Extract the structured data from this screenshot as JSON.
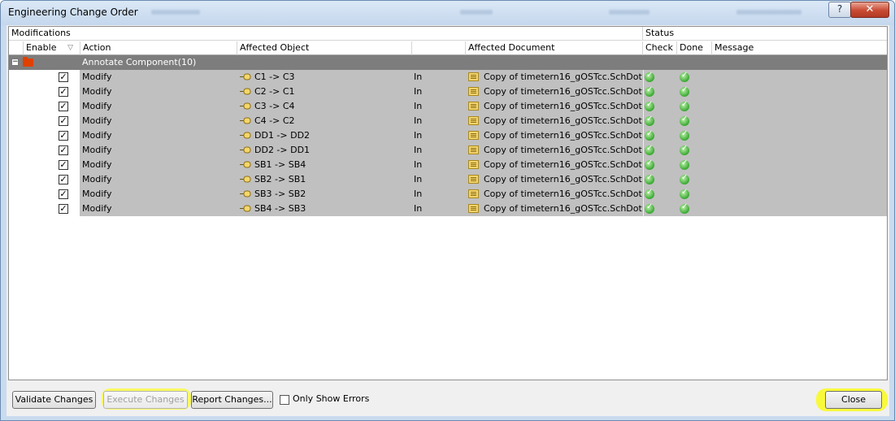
{
  "window": {
    "title": "Engineering Change Order",
    "help_button": "?",
    "close_button": "✕"
  },
  "headers": {
    "group_modifications": "Modifications",
    "group_status": "Status",
    "enable": "Enable",
    "action": "Action",
    "affected_object": "Affected Object",
    "affected_document": "Affected Document",
    "check": "Check",
    "done": "Done",
    "message": "Message"
  },
  "group": {
    "label": "Annotate Component(10)"
  },
  "rows": [
    {
      "enabled": true,
      "action": "Modify",
      "object": "C1 -> C3",
      "direction": "In",
      "document": "Copy of timetern16_gOSTcc.SchDot",
      "check": "ok",
      "done": "ok",
      "message": ""
    },
    {
      "enabled": true,
      "action": "Modify",
      "object": "C2 -> C1",
      "direction": "In",
      "document": "Copy of timetern16_gOSTcc.SchDot",
      "check": "ok",
      "done": "ok",
      "message": ""
    },
    {
      "enabled": true,
      "action": "Modify",
      "object": "C3 -> C4",
      "direction": "In",
      "document": "Copy of timetern16_gOSTcc.SchDot",
      "check": "ok",
      "done": "ok",
      "message": ""
    },
    {
      "enabled": true,
      "action": "Modify",
      "object": "C4 -> C2",
      "direction": "In",
      "document": "Copy of timetern16_gOSTcc.SchDot",
      "check": "ok",
      "done": "ok",
      "message": ""
    },
    {
      "enabled": true,
      "action": "Modify",
      "object": "DD1 -> DD2",
      "direction": "In",
      "document": "Copy of timetern16_gOSTcc.SchDot",
      "check": "ok",
      "done": "ok",
      "message": ""
    },
    {
      "enabled": true,
      "action": "Modify",
      "object": "DD2 -> DD1",
      "direction": "In",
      "document": "Copy of timetern16_gOSTcc.SchDot",
      "check": "ok",
      "done": "ok",
      "message": ""
    },
    {
      "enabled": true,
      "action": "Modify",
      "object": "SB1 -> SB4",
      "direction": "In",
      "document": "Copy of timetern16_gOSTcc.SchDot",
      "check": "ok",
      "done": "ok",
      "message": ""
    },
    {
      "enabled": true,
      "action": "Modify",
      "object": "SB2 -> SB1",
      "direction": "In",
      "document": "Copy of timetern16_gOSTcc.SchDot",
      "check": "ok",
      "done": "ok",
      "message": ""
    },
    {
      "enabled": true,
      "action": "Modify",
      "object": "SB3 -> SB2",
      "direction": "In",
      "document": "Copy of timetern16_gOSTcc.SchDot",
      "check": "ok",
      "done": "ok",
      "message": ""
    },
    {
      "enabled": true,
      "action": "Modify",
      "object": "SB4 -> SB3",
      "direction": "In",
      "document": "Copy of timetern16_gOSTcc.SchDot",
      "check": "ok",
      "done": "ok",
      "message": ""
    }
  ],
  "buttons": {
    "validate": "Validate Changes",
    "execute": "Execute Changes",
    "report": "Report Changes...",
    "only_show_errors": "Only Show Errors",
    "close": "Close"
  },
  "icons": {
    "expand": "minus-box-icon",
    "group": "folder-icon",
    "object": "component-arrow-icon",
    "document": "schematic-doc-icon",
    "status": "green-check-circle-icon"
  },
  "colors": {
    "row_background": "#c0c0c0",
    "group_row": "#7d7d7d",
    "highlight": "#fafa46",
    "status_ok": "#3aa832"
  }
}
